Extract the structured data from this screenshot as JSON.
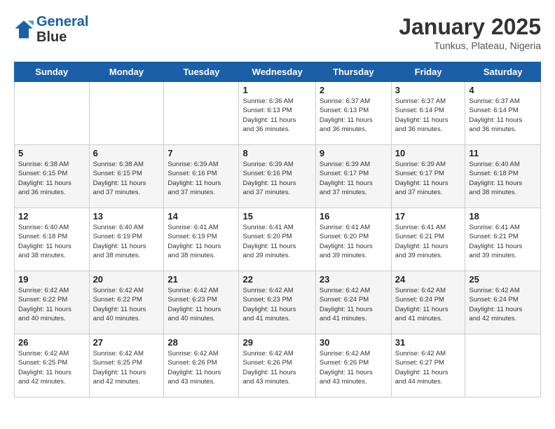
{
  "header": {
    "logo_line1": "General",
    "logo_line2": "Blue",
    "month": "January 2025",
    "location": "Tunkus, Plateau, Nigeria"
  },
  "weekdays": [
    "Sunday",
    "Monday",
    "Tuesday",
    "Wednesday",
    "Thursday",
    "Friday",
    "Saturday"
  ],
  "weeks": [
    [
      {
        "day": "",
        "info": ""
      },
      {
        "day": "",
        "info": ""
      },
      {
        "day": "",
        "info": ""
      },
      {
        "day": "1",
        "info": "Sunrise: 6:36 AM\nSunset: 6:13 PM\nDaylight: 11 hours\nand 36 minutes."
      },
      {
        "day": "2",
        "info": "Sunrise: 6:37 AM\nSunset: 6:13 PM\nDaylight: 11 hours\nand 36 minutes."
      },
      {
        "day": "3",
        "info": "Sunrise: 6:37 AM\nSunset: 6:14 PM\nDaylight: 11 hours\nand 36 minutes."
      },
      {
        "day": "4",
        "info": "Sunrise: 6:37 AM\nSunset: 6:14 PM\nDaylight: 11 hours\nand 36 minutes."
      }
    ],
    [
      {
        "day": "5",
        "info": "Sunrise: 6:38 AM\nSunset: 6:15 PM\nDaylight: 11 hours\nand 36 minutes."
      },
      {
        "day": "6",
        "info": "Sunrise: 6:38 AM\nSunset: 6:15 PM\nDaylight: 11 hours\nand 37 minutes."
      },
      {
        "day": "7",
        "info": "Sunrise: 6:39 AM\nSunset: 6:16 PM\nDaylight: 11 hours\nand 37 minutes."
      },
      {
        "day": "8",
        "info": "Sunrise: 6:39 AM\nSunset: 6:16 PM\nDaylight: 11 hours\nand 37 minutes."
      },
      {
        "day": "9",
        "info": "Sunrise: 6:39 AM\nSunset: 6:17 PM\nDaylight: 11 hours\nand 37 minutes."
      },
      {
        "day": "10",
        "info": "Sunrise: 6:39 AM\nSunset: 6:17 PM\nDaylight: 11 hours\nand 37 minutes."
      },
      {
        "day": "11",
        "info": "Sunrise: 6:40 AM\nSunset: 6:18 PM\nDaylight: 11 hours\nand 38 minutes."
      }
    ],
    [
      {
        "day": "12",
        "info": "Sunrise: 6:40 AM\nSunset: 6:18 PM\nDaylight: 11 hours\nand 38 minutes."
      },
      {
        "day": "13",
        "info": "Sunrise: 6:40 AM\nSunset: 6:19 PM\nDaylight: 11 hours\nand 38 minutes."
      },
      {
        "day": "14",
        "info": "Sunrise: 6:41 AM\nSunset: 6:19 PM\nDaylight: 11 hours\nand 38 minutes."
      },
      {
        "day": "15",
        "info": "Sunrise: 6:41 AM\nSunset: 6:20 PM\nDaylight: 11 hours\nand 39 minutes."
      },
      {
        "day": "16",
        "info": "Sunrise: 6:41 AM\nSunset: 6:20 PM\nDaylight: 11 hours\nand 39 minutes."
      },
      {
        "day": "17",
        "info": "Sunrise: 6:41 AM\nSunset: 6:21 PM\nDaylight: 11 hours\nand 39 minutes."
      },
      {
        "day": "18",
        "info": "Sunrise: 6:41 AM\nSunset: 6:21 PM\nDaylight: 11 hours\nand 39 minutes."
      }
    ],
    [
      {
        "day": "19",
        "info": "Sunrise: 6:42 AM\nSunset: 6:22 PM\nDaylight: 11 hours\nand 40 minutes."
      },
      {
        "day": "20",
        "info": "Sunrise: 6:42 AM\nSunset: 6:22 PM\nDaylight: 11 hours\nand 40 minutes."
      },
      {
        "day": "21",
        "info": "Sunrise: 6:42 AM\nSunset: 6:23 PM\nDaylight: 11 hours\nand 40 minutes."
      },
      {
        "day": "22",
        "info": "Sunrise: 6:42 AM\nSunset: 6:23 PM\nDaylight: 11 hours\nand 41 minutes."
      },
      {
        "day": "23",
        "info": "Sunrise: 6:42 AM\nSunset: 6:24 PM\nDaylight: 11 hours\nand 41 minutes."
      },
      {
        "day": "24",
        "info": "Sunrise: 6:42 AM\nSunset: 6:24 PM\nDaylight: 11 hours\nand 41 minutes."
      },
      {
        "day": "25",
        "info": "Sunrise: 6:42 AM\nSunset: 6:24 PM\nDaylight: 11 hours\nand 42 minutes."
      }
    ],
    [
      {
        "day": "26",
        "info": "Sunrise: 6:42 AM\nSunset: 6:25 PM\nDaylight: 11 hours\nand 42 minutes."
      },
      {
        "day": "27",
        "info": "Sunrise: 6:42 AM\nSunset: 6:25 PM\nDaylight: 11 hours\nand 42 minutes."
      },
      {
        "day": "28",
        "info": "Sunrise: 6:42 AM\nSunset: 6:26 PM\nDaylight: 11 hours\nand 43 minutes."
      },
      {
        "day": "29",
        "info": "Sunrise: 6:42 AM\nSunset: 6:26 PM\nDaylight: 11 hours\nand 43 minutes."
      },
      {
        "day": "30",
        "info": "Sunrise: 6:42 AM\nSunset: 6:26 PM\nDaylight: 11 hours\nand 43 minutes."
      },
      {
        "day": "31",
        "info": "Sunrise: 6:42 AM\nSunset: 6:27 PM\nDaylight: 11 hours\nand 44 minutes."
      },
      {
        "day": "",
        "info": ""
      }
    ]
  ]
}
